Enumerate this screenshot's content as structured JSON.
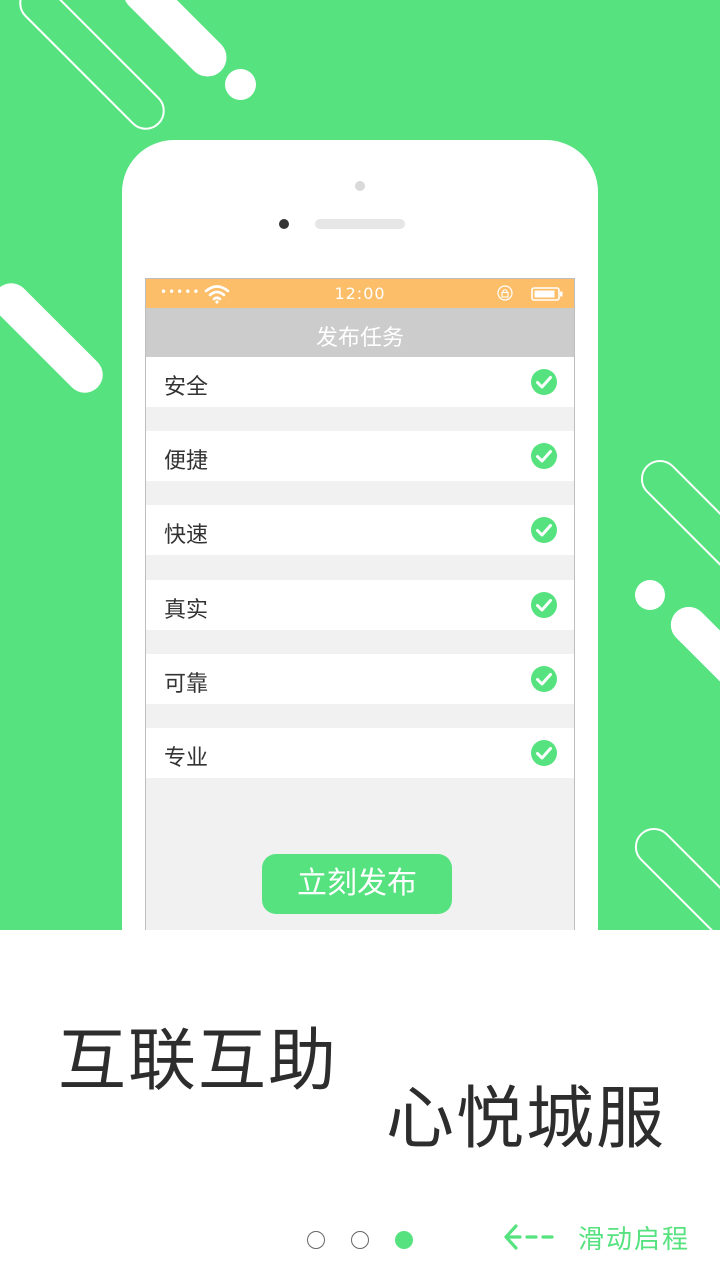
{
  "colors": {
    "accent": "#55e27f",
    "status_bar": "#fcbe69",
    "nav_bar": "#cccccc",
    "screen_bg": "#f1f1f1",
    "text_dark": "#2d2d2d"
  },
  "status_bar": {
    "signal": "•••••",
    "time": "12:00",
    "icons": [
      "wifi-icon",
      "lock-icon",
      "battery-icon"
    ]
  },
  "nav": {
    "title": "发布任务"
  },
  "list": {
    "items": [
      {
        "label": "安全",
        "checked": true
      },
      {
        "label": "便捷",
        "checked": true
      },
      {
        "label": "快速",
        "checked": true
      },
      {
        "label": "真实",
        "checked": true
      },
      {
        "label": "可靠",
        "checked": true
      },
      {
        "label": "专业",
        "checked": true
      }
    ]
  },
  "publish_button": {
    "label": "立刻发布"
  },
  "slogan": {
    "line1": "互联互助",
    "line2": "心悦城服"
  },
  "pager": {
    "total": 3,
    "active_index": 2
  },
  "swipe": {
    "label": "滑动启程",
    "icon": "arrow-left-icon"
  }
}
